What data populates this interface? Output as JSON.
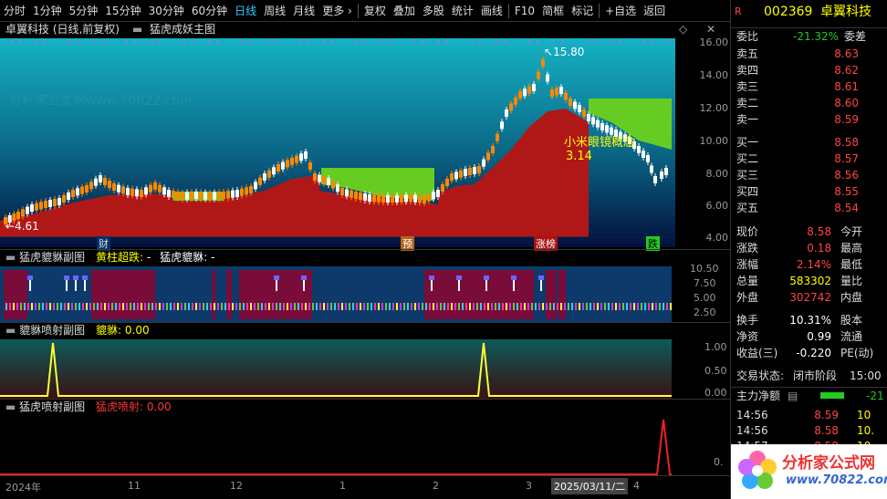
{
  "toolbar": {
    "items": [
      "分时",
      "1分钟",
      "5分钟",
      "15分钟",
      "30分钟",
      "60分钟",
      "日线",
      "周线",
      "月线",
      "更多 ›",
      "复权",
      "叠加",
      "多股",
      "统计",
      "画线",
      "F10",
      "简框",
      "标记",
      "+自选",
      "返回"
    ],
    "selected": "日线"
  },
  "main": {
    "title": "卓翼科技 (日线,前复权)",
    "indicator": "猛虎成妖主图",
    "high_label": "15.80",
    "low_label": "4.61",
    "annotation_line1": "小米眼镜概念",
    "annotation_line2": "3.14",
    "y_ticks": [
      "16.00",
      "14.00",
      "12.00",
      "10.00",
      "8.00",
      "6.00",
      "4.00"
    ],
    "markers": [
      "财",
      "预",
      "涨榜",
      "跌"
    ]
  },
  "pane2": {
    "name": "猛虎貔貅副图",
    "label": "黄柱超跌:",
    "value": "-",
    "label2": "猛虎貔貅:",
    "value2": "-",
    "y_ticks": [
      "10.50",
      "7.50",
      "5.00",
      "2.50"
    ]
  },
  "pane3": {
    "name": "貔貅喷射副图",
    "label": "貔貅:",
    "value": "0.00",
    "y_ticks": [
      "1.00",
      "0.50",
      "0.00"
    ]
  },
  "pane4": {
    "name": "猛虎喷射副图",
    "label": "猛虎喷射:",
    "value": "0.00",
    "y_ticks": [
      "0."
    ]
  },
  "x_axis": {
    "labels": [
      "2024年",
      "11",
      "12",
      "1",
      "2",
      "3",
      "4"
    ],
    "cursor_date": "2025/03/11/二"
  },
  "quote": {
    "code": "002369",
    "name": "卓翼科技",
    "webi_label": "委比",
    "webi": "-21.32%",
    "weicha_label": "委差",
    "asks": [
      {
        "l": "卖五",
        "p": "8.63"
      },
      {
        "l": "卖四",
        "p": "8.62"
      },
      {
        "l": "卖三",
        "p": "8.61"
      },
      {
        "l": "卖二",
        "p": "8.60"
      },
      {
        "l": "卖一",
        "p": "8.59"
      }
    ],
    "bids": [
      {
        "l": "买一",
        "p": "8.58"
      },
      {
        "l": "买二",
        "p": "8.57"
      },
      {
        "l": "买三",
        "p": "8.56"
      },
      {
        "l": "买四",
        "p": "8.55"
      },
      {
        "l": "买五",
        "p": "8.54"
      }
    ],
    "stats": [
      {
        "l": "现价",
        "v": "8.58",
        "r": "今开"
      },
      {
        "l": "涨跌",
        "v": "0.18",
        "r": "最高"
      },
      {
        "l": "涨幅",
        "v": "2.14%",
        "r": "最低"
      },
      {
        "l": "总量",
        "v": "583302",
        "r": "量比"
      },
      {
        "l": "外盘",
        "v": "302742",
        "r": "内盘"
      }
    ],
    "stats2": [
      {
        "l": "换手",
        "v": "10.31%",
        "r": "股本"
      },
      {
        "l": "净资",
        "v": "0.99",
        "r": "流通"
      },
      {
        "l": "收益(三)",
        "v": "-0.220",
        "r": "PE(动)"
      }
    ],
    "trade_state_label": "交易状态:",
    "trade_state": "闭市阶段",
    "trade_time": "15:00",
    "main_flow_label": "主力净额",
    "main_flow_value": "-21",
    "ticks": [
      {
        "t": "14:56",
        "p": "8.59",
        "v": "10"
      },
      {
        "t": "14:56",
        "p": "8.58",
        "v": "10."
      },
      {
        "t": "14:57",
        "p": "8.58",
        "v": "10."
      }
    ]
  },
  "watermark": "分析家公式网www.70822.com",
  "logo": {
    "text": "分析家公式网",
    "url": "www.70822.com"
  }
}
